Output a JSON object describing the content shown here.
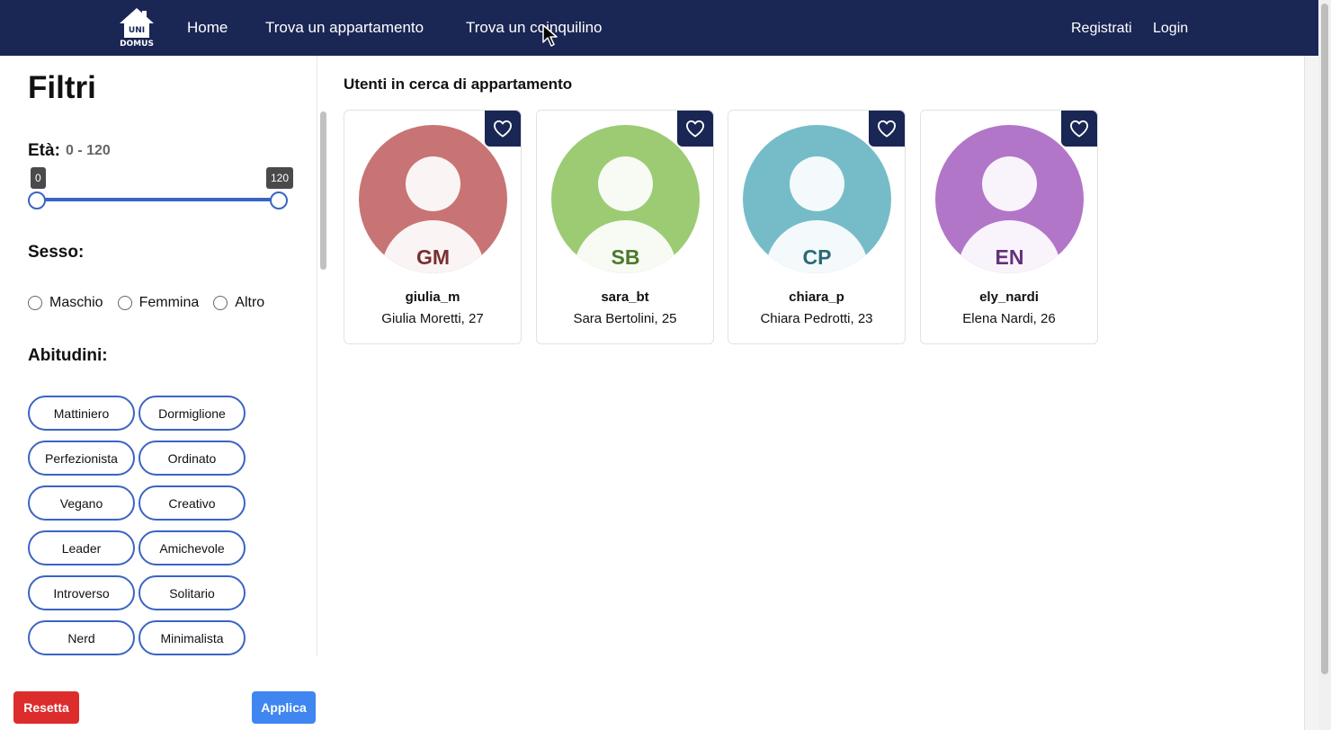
{
  "navbar": {
    "logo": {
      "line1": "UNI",
      "line2": "DOMUS",
      "icon": "house-icon"
    },
    "links": [
      "Home",
      "Trova un appartamento",
      "Trova un coinquilino"
    ],
    "right_links": [
      "Registrati",
      "Login"
    ]
  },
  "sidebar": {
    "title": "Filtri",
    "age": {
      "label": "Età:",
      "range": "0 - 120",
      "min": "0",
      "max": "120"
    },
    "sex": {
      "label": "Sesso:",
      "options": [
        "Maschio",
        "Femmina",
        "Altro"
      ]
    },
    "habits": {
      "label": "Abitudini:",
      "chips": [
        "Mattiniero",
        "Dormiglione",
        "Perfezionista",
        "Ordinato",
        "Vegano",
        "Creativo",
        "Leader",
        "Amichevole",
        "Introverso",
        "Solitario",
        "Nerd",
        "Minimalista"
      ]
    },
    "reset_label": "Resetta",
    "apply_label": "Applica"
  },
  "main": {
    "title": "Utenti in cerca di appartamento",
    "users": [
      {
        "initials": "GM",
        "username": "giulia_m",
        "name": "Giulia Moretti, 27",
        "bg": "#c87474",
        "text_color": "#7a3030"
      },
      {
        "initials": "SB",
        "username": "sara_bt",
        "name": "Sara Bertolini, 25",
        "bg": "#9ccb74",
        "text_color": "#4a7a2a"
      },
      {
        "initials": "CP",
        "username": "chiara_p",
        "name": "Chiara Pedrotti, 23",
        "bg": "#76bcc8",
        "text_color": "#2a6a76"
      },
      {
        "initials": "EN",
        "username": "ely_nardi",
        "name": "Elena Nardi, 26",
        "bg": "#b276c8",
        "text_color": "#64307a"
      }
    ]
  },
  "colors": {
    "navbar": "#1a2654",
    "accent": "#3a64c4",
    "reset": "#dc2c2c",
    "apply": "#3f86f0"
  }
}
